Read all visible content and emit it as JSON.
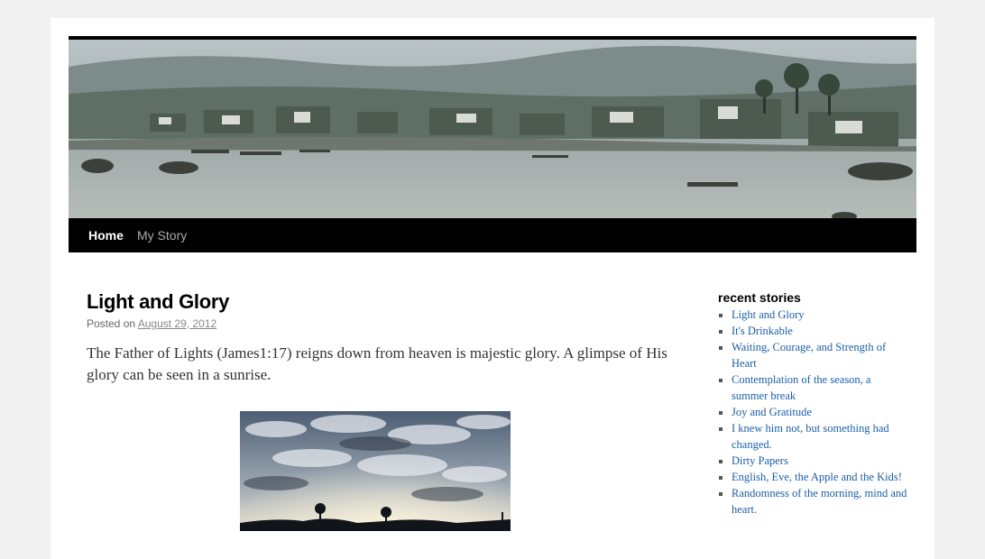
{
  "nav": {
    "home_label": "Home",
    "story_label": "My Story"
  },
  "post": {
    "title": "Light and Glory",
    "meta_prefix": "Posted on",
    "date": "August 29, 2012",
    "body": "The Father of Lights (James1:17) reigns down from heaven is majestic glory. A glimpse of His glory can be seen in a sunrise."
  },
  "sidebar": {
    "title": "recent stories",
    "items": [
      {
        "label": "Light and Glory"
      },
      {
        "label": "It's Drinkable"
      },
      {
        "label": "Waiting, Courage, and Strength of Heart"
      },
      {
        "label": "Contemplation of the season, a summer break"
      },
      {
        "label": "Joy and Gratitude"
      },
      {
        "label": "I knew him not, but something had changed."
      },
      {
        "label": "Dirty Papers"
      },
      {
        "label": "English, Eve, the Apple and the Kids!"
      },
      {
        "label": "Randomness of the morning, mind and heart."
      }
    ]
  },
  "colors": {
    "link": "#1b5ea8",
    "nav_bg": "#000000"
  }
}
